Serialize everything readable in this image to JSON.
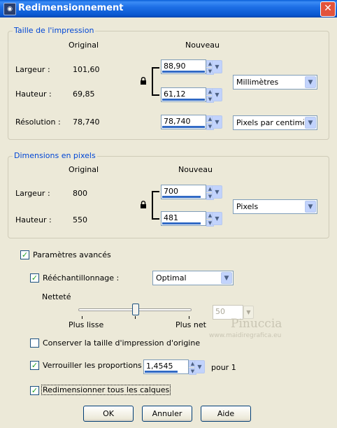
{
  "window": {
    "title": "Redimensionnement",
    "close_glyph": "✕"
  },
  "print_group": {
    "legend": "Taille de l'impression",
    "col_original": "Original",
    "col_nouveau": "Nouveau",
    "width_label": "Largeur :",
    "width_original": "101,60",
    "width_value": "88,90",
    "height_label": "Hauteur :",
    "height_original": "69,85",
    "height_value": "61,12",
    "unit": "Millimètres",
    "res_label": "Résolution :",
    "res_original": "78,740",
    "res_value": "78,740",
    "res_unit": "Pixels par centimètre"
  },
  "pixel_group": {
    "legend": "Dimensions en pixels",
    "col_original": "Original",
    "col_nouveau": "Nouveau",
    "width_label": "Largeur :",
    "width_original": "800",
    "width_value": "700",
    "height_label": "Hauteur :",
    "height_original": "550",
    "height_value": "481",
    "unit": "Pixels"
  },
  "advanced": {
    "label": "Paramètres avancés",
    "checked": true,
    "resample_label": "Rééchantillonnage :",
    "resample_checked": true,
    "resample_value": "Optimal",
    "sharpness_label": "Netteté",
    "sharpness_value": "50",
    "sharpness_level": 0.5,
    "slider_left": "Plus lisse",
    "slider_right": "Plus net",
    "keep_print_label": "Conserver la taille d'impression d'origine",
    "keep_print_checked": false,
    "lock_ratio_label": "Verrouiller les proportions :",
    "lock_ratio_checked": true,
    "ratio_value": "1,4545",
    "ratio_suffix": "pour 1",
    "resize_layers_label": "Redimensionner tous les calques",
    "resize_layers_checked": true
  },
  "buttons": {
    "ok": "OK",
    "cancel": "Annuler",
    "help": "Aide"
  },
  "watermark": {
    "name": "Pinuccia",
    "url": "www.maidiregrafica.eu"
  },
  "colors": {
    "title_blue": "#0a58d0",
    "legend_blue": "#0046d5",
    "check_green": "#21a121",
    "progress_blue": "#316ac5"
  }
}
